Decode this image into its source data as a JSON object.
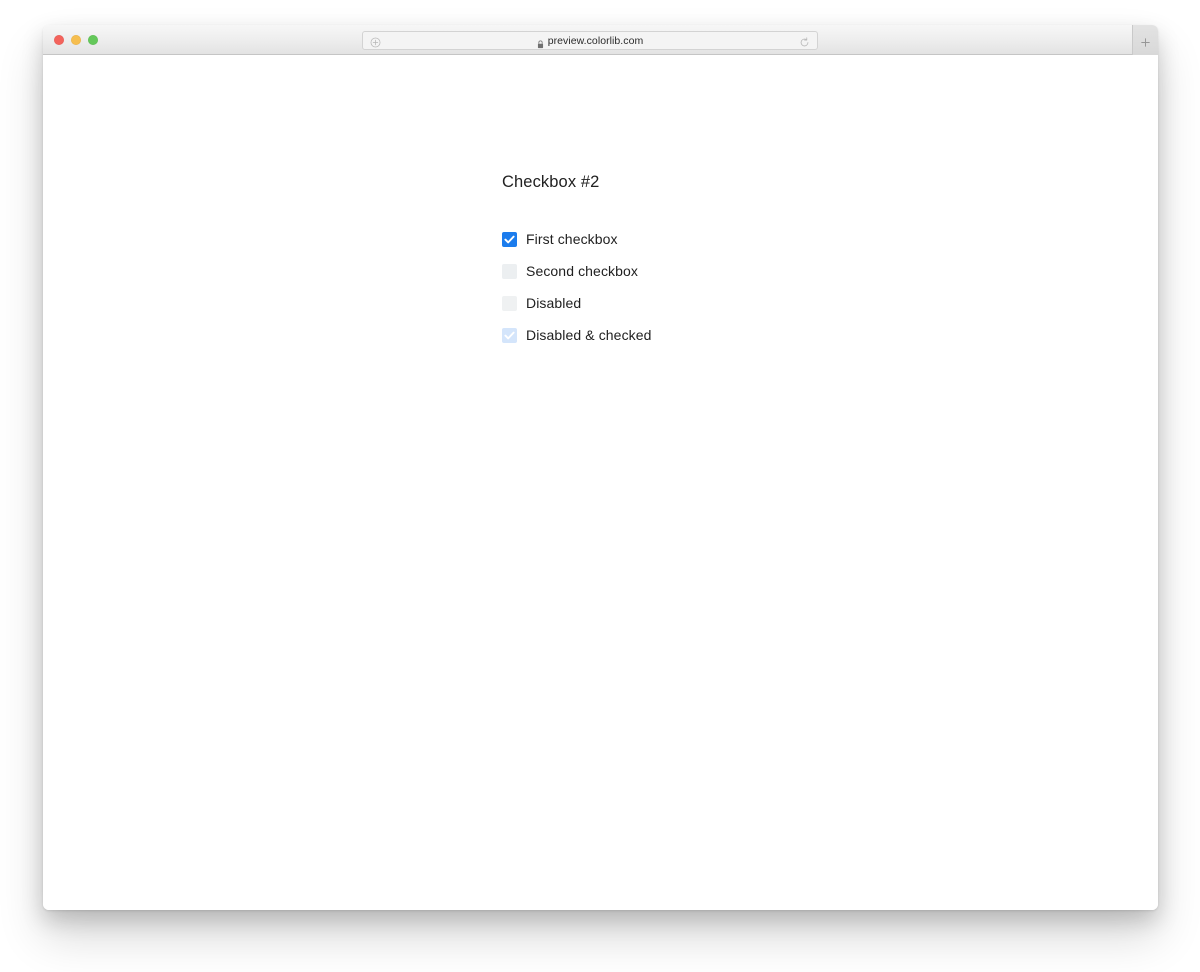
{
  "browser": {
    "traffic_lights": [
      {
        "name": "close",
        "color": "#f3635c"
      },
      {
        "name": "minimize",
        "color": "#f6be4f"
      },
      {
        "name": "zoom",
        "color": "#64c85a"
      }
    ],
    "address_bar": {
      "url": "preview.colorlib.com",
      "lock_icon": "lock-icon",
      "site_info_icon": "circle-plus-icon",
      "reload_icon": "reload-icon"
    },
    "new_tab_icon": "plus-icon"
  },
  "page": {
    "title": "Checkbox #2",
    "checkboxes": [
      {
        "label": "First checkbox",
        "state": "checked",
        "checked": true,
        "disabled": false
      },
      {
        "label": "Second checkbox",
        "state": "unchecked",
        "checked": false,
        "disabled": false
      },
      {
        "label": "Disabled",
        "state": "disabled-unchecked",
        "checked": false,
        "disabled": true
      },
      {
        "label": "Disabled & checked",
        "state": "disabled-checked",
        "checked": true,
        "disabled": true
      }
    ]
  },
  "colors": {
    "accent": "#1b7ced",
    "accent_muted": "#d4e5fb",
    "box_idle": "#eceff1",
    "text": "#212121",
    "page_background": "#ffffff"
  }
}
